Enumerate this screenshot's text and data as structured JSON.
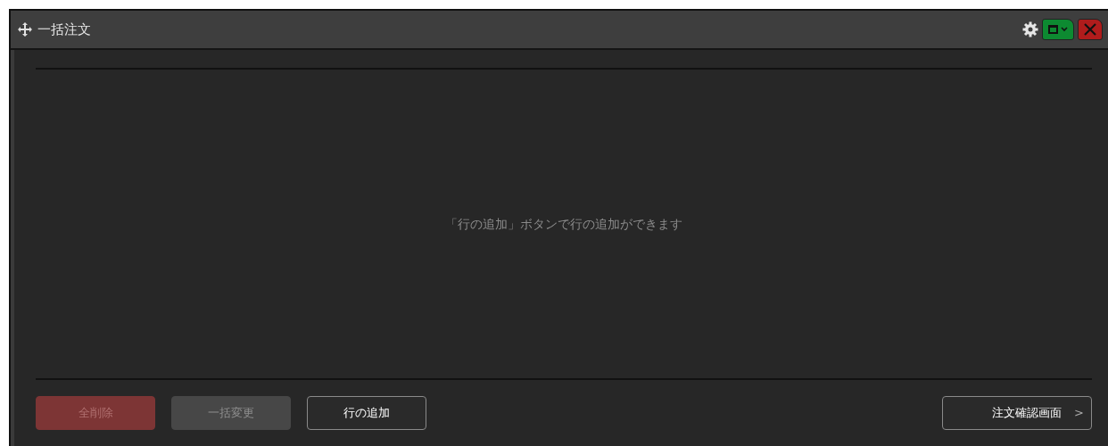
{
  "window": {
    "title": "一括注文"
  },
  "empty_message": "「行の追加」ボタンで行の追加ができます",
  "buttons": [
    {
      "label": "全削除",
      "kind": "danger",
      "disabled": true
    },
    {
      "label": "一括変更",
      "kind": "normal",
      "disabled": true
    },
    {
      "label": "行の追加",
      "kind": "normal",
      "disabled": false
    }
  ],
  "confirm_button": {
    "label": "注文確認画面",
    "chevron": ">"
  }
}
